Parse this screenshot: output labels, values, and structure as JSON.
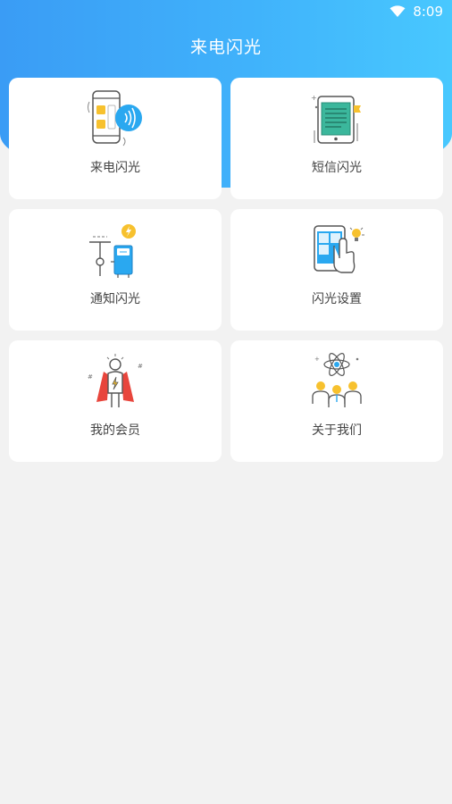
{
  "status_bar": {
    "time": "8:09",
    "icons": [
      "wifi-icon"
    ]
  },
  "header": {
    "title": "来电闪光"
  },
  "menu": {
    "items": [
      {
        "label": "来电闪光",
        "icon": "phone-call-flash-icon"
      },
      {
        "label": "短信闪光",
        "icon": "sms-tablet-icon"
      },
      {
        "label": "通知闪光",
        "icon": "notification-flash-icon"
      },
      {
        "label": "闪光设置",
        "icon": "flash-settings-icon"
      },
      {
        "label": "我的会员",
        "icon": "superhero-member-icon"
      },
      {
        "label": "关于我们",
        "icon": "about-team-icon"
      }
    ]
  },
  "colors": {
    "header_start": "#3a9cf5",
    "header_end": "#48c8fe",
    "background": "#f2f2f2",
    "card": "#ffffff"
  }
}
